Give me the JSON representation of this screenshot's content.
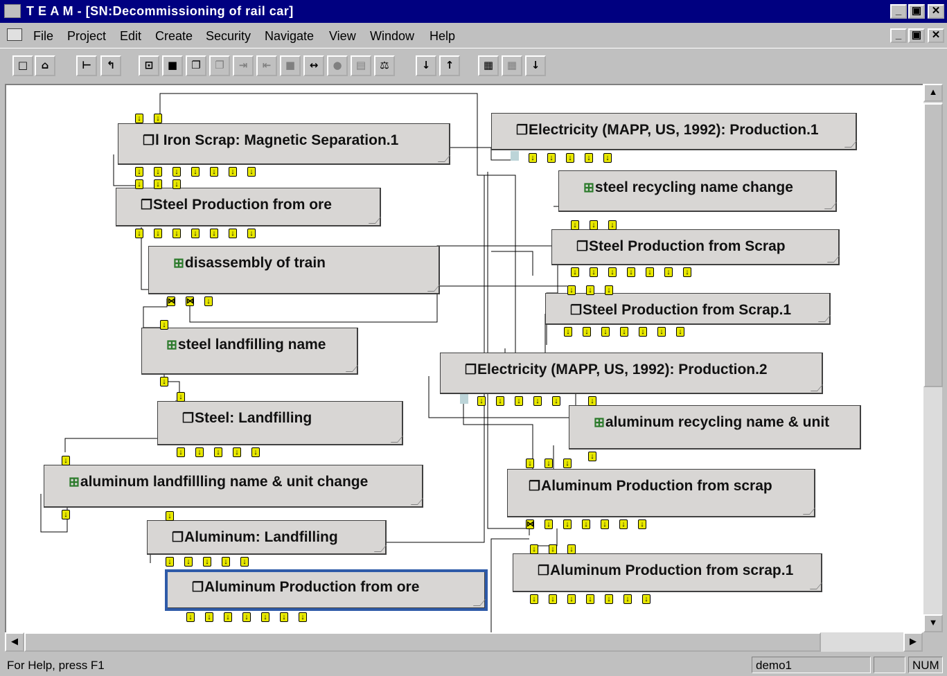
{
  "window": {
    "title": "T E A M - [SN:Decommissioning of rail car]"
  },
  "menu": [
    "File",
    "Project",
    "Edit",
    "Create",
    "Security",
    "Navigate",
    "View",
    "Window",
    "Help"
  ],
  "toolbar": {
    "buttons": [
      "new",
      "open",
      "tree",
      "up",
      "process",
      "module",
      "group",
      "group-disabled",
      "step-in",
      "step-out",
      "block",
      "span",
      "bullet",
      "table",
      "scale",
      "lock-down",
      "lock-up",
      "report",
      "grid",
      "down"
    ]
  },
  "nodes": [
    {
      "id": "iron-scrap",
      "label": "l Iron Scrap: Magnetic Separation.1",
      "icon": "group"
    },
    {
      "id": "elec-1",
      "label": "Electricity (MAPP, US, 1992): Production.1",
      "icon": "group"
    },
    {
      "id": "steel-recycling",
      "label": "steel recycling name change",
      "icon": "module"
    },
    {
      "id": "steel-ore",
      "label": "Steel Production from ore",
      "icon": "group"
    },
    {
      "id": "steel-scrap",
      "label": "Steel Production from Scrap",
      "icon": "group"
    },
    {
      "id": "disassembly",
      "label": "disassembly of train",
      "icon": "module"
    },
    {
      "id": "steel-scrap-1",
      "label": "Steel Production from Scrap.1",
      "icon": "group"
    },
    {
      "id": "steel-landfilling-name",
      "label": "steel landfilling name",
      "icon": "module"
    },
    {
      "id": "elec-2",
      "label": "Electricity (MAPP, US, 1992): Production.2",
      "icon": "group"
    },
    {
      "id": "steel-landfilling",
      "label": "Steel: Landfilling",
      "icon": "group"
    },
    {
      "id": "alu-recycling",
      "label": "aluminum recycling name & unit",
      "icon": "module"
    },
    {
      "id": "alu-landfill-name",
      "label": "aluminum landfillling name & unit change",
      "icon": "module"
    },
    {
      "id": "alu-scrap",
      "label": "Aluminum Production from scrap",
      "icon": "group"
    },
    {
      "id": "alu-landfilling",
      "label": "Aluminum: Landfilling",
      "icon": "group"
    },
    {
      "id": "alu-scrap-1",
      "label": "Aluminum Production from scrap.1",
      "icon": "group"
    },
    {
      "id": "alu-ore",
      "label": "Aluminum Production from ore",
      "icon": "group",
      "selected": true
    }
  ],
  "status": {
    "help": "For Help, press F1",
    "user": "demo1",
    "blank": "",
    "num": "NUM"
  }
}
